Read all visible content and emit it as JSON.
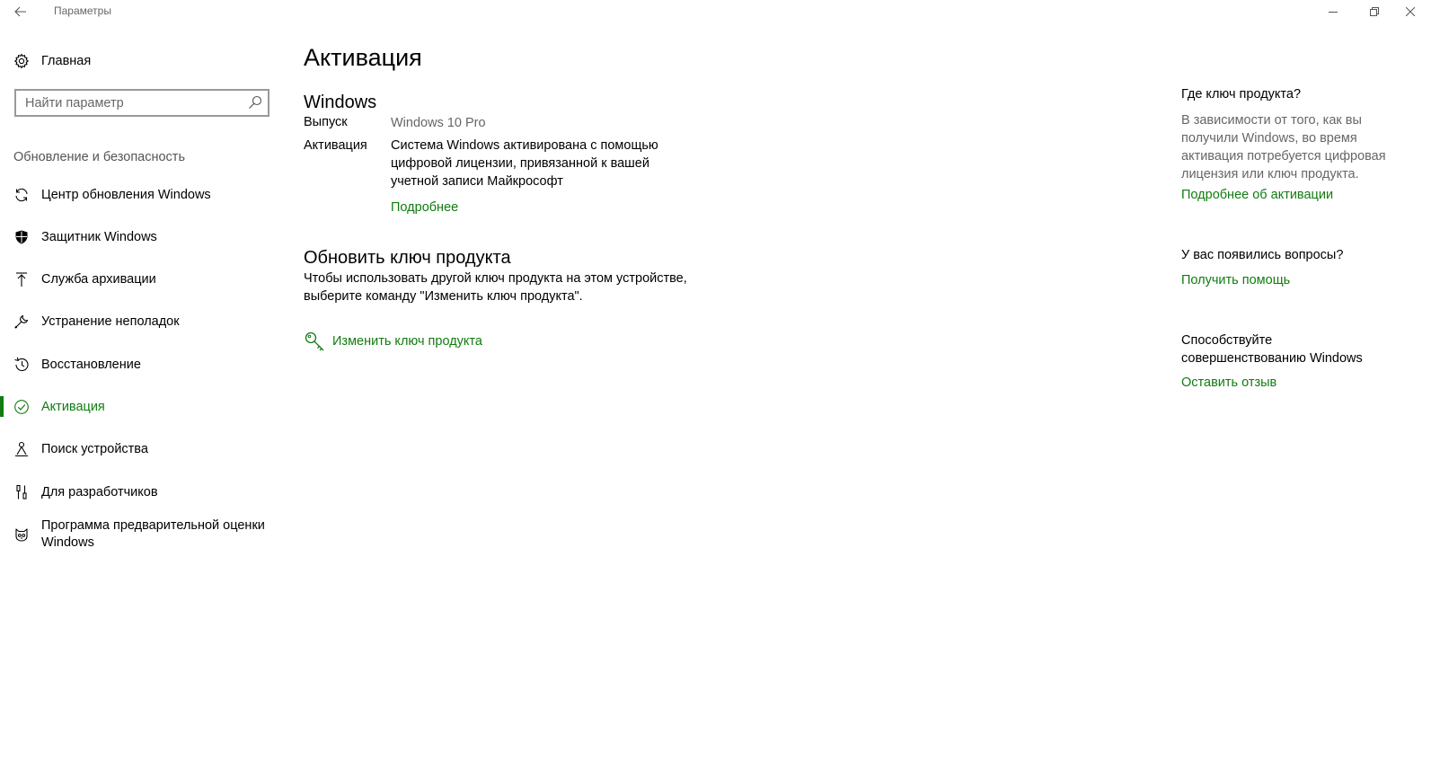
{
  "window": {
    "title": "Параметры"
  },
  "sidebar": {
    "home_label": "Главная",
    "search_placeholder": "Найти параметр",
    "section_header": "Обновление и безопасность",
    "items": [
      {
        "label": "Центр обновления Windows",
        "icon": "refresh-icon"
      },
      {
        "label": "Защитник Windows",
        "icon": "shield-icon"
      },
      {
        "label": "Служба архивации",
        "icon": "upload-arrow-icon"
      },
      {
        "label": "Устранение неполадок",
        "icon": "wrench-icon"
      },
      {
        "label": "Восстановление",
        "icon": "history-icon"
      },
      {
        "label": "Активация",
        "icon": "check-circle-icon",
        "active": true
      },
      {
        "label": "Поиск устройства",
        "icon": "person-location-icon"
      },
      {
        "label": "Для разработчиков",
        "icon": "developer-tools-icon"
      },
      {
        "label": "Программа предварительной оценки Windows",
        "icon": "insider-cat-icon"
      }
    ]
  },
  "main": {
    "title": "Активация",
    "windows_section": {
      "heading": "Windows",
      "edition_label": "Выпуск",
      "edition_value": "Windows 10 Pro",
      "activation_label": "Активация",
      "activation_value": "Система Windows активирована с помощью цифровой лицензии, привязанной к вашей учетной записи Майкрософт",
      "more_link": "Подробнее"
    },
    "key_section": {
      "heading": "Обновить ключ продукта",
      "description": "Чтобы использовать другой ключ продукта на этом устройстве, выберите команду \"Изменить ключ продукта\".",
      "change_key_link": "Изменить ключ продукта"
    }
  },
  "right_panel": {
    "where_key_heading": "Где ключ продукта?",
    "where_key_text": "В зависимости от того, как вы получили Windows, во время активация потребуется цифровая лицензия или ключ продукта.",
    "activation_more_link": "Подробнее об активации",
    "questions_heading": "У вас появились вопросы?",
    "help_link": "Получить помощь",
    "feedback_heading": "Способствуйте совершенствованию Windows",
    "feedback_link": "Оставить отзыв"
  },
  "colors": {
    "accent": "#107c10",
    "secondary_text": "#666666"
  }
}
